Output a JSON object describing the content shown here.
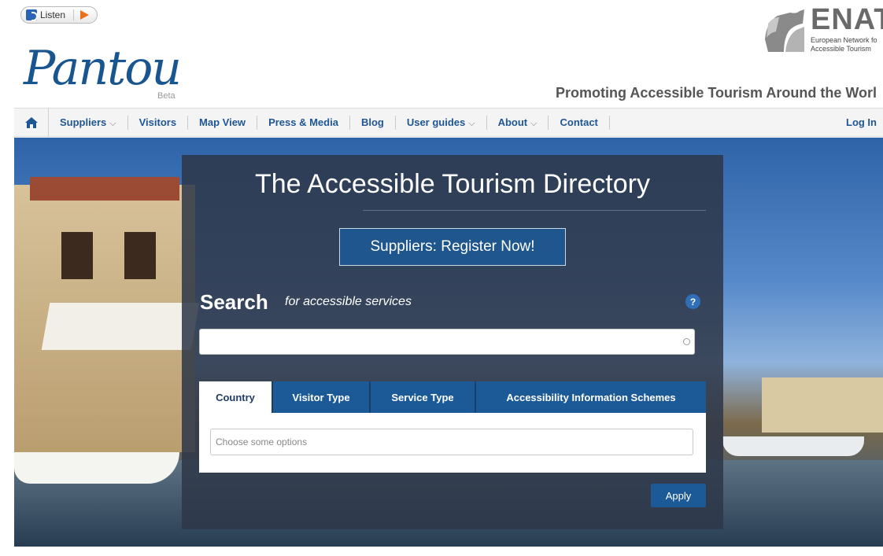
{
  "listen": {
    "label": "Listen"
  },
  "logo": {
    "word": "Pantou",
    "beta": "Beta"
  },
  "enat": {
    "name": "ENAT",
    "sub_line1": "European Network fo",
    "sub_line2": "Accessible Tourism"
  },
  "tagline": "Promoting Accessible Tourism Around the Worl",
  "nav": {
    "items": [
      {
        "label": "Suppliers",
        "dropdown": true
      },
      {
        "label": "Visitors",
        "dropdown": false
      },
      {
        "label": "Map View",
        "dropdown": false
      },
      {
        "label": "Press & Media",
        "dropdown": false
      },
      {
        "label": "Blog",
        "dropdown": false
      },
      {
        "label": "User guides",
        "dropdown": true
      },
      {
        "label": "About",
        "dropdown": true
      },
      {
        "label": "Contact",
        "dropdown": false
      }
    ],
    "login": "Log In",
    "caret": "⌵"
  },
  "hero": {
    "title": "The Accessible Tourism Directory",
    "register_label": "Suppliers: Register Now!",
    "search_heading": "Search",
    "search_sub": "for accessible services",
    "help": "?",
    "search_value": "",
    "tabs": [
      {
        "label": "Country",
        "active": true
      },
      {
        "label": "Visitor Type",
        "active": false
      },
      {
        "label": "Service Type",
        "active": false
      },
      {
        "label": "Accessibility Information Schemes",
        "active": false
      }
    ],
    "options_placeholder": "Choose some options",
    "apply_label": "Apply"
  },
  "colors": {
    "brand": "#1b5a97",
    "nav_text": "#1f5694",
    "accent": "#e8711c"
  }
}
